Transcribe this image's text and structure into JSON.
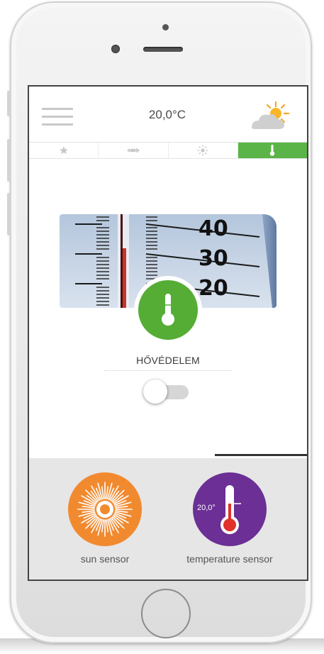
{
  "header": {
    "temperature": "20,0°C",
    "menu_icon": "hamburger-icon",
    "weather_icon": "sun-behind-cloud-icon"
  },
  "tabs": [
    {
      "icon": "star-icon",
      "active": false
    },
    {
      "icon": "wind-icon",
      "active": false
    },
    {
      "icon": "sun-icon",
      "active": false
    },
    {
      "icon": "thermometer-icon",
      "active": true
    }
  ],
  "hero": {
    "scale_labels": [
      "40",
      "30",
      "20"
    ],
    "badge_icon": "thermometer-icon"
  },
  "feature": {
    "label": "HŐVÉDELEM",
    "toggle_on": false
  },
  "sensors": [
    {
      "name": "sun sensor",
      "icon": "sunburst-icon",
      "color": "#f18a2f"
    },
    {
      "name": "temperature sensor",
      "icon": "thermometer-icon",
      "color": "#6b2f95",
      "value": "20,0°"
    }
  ],
  "colors": {
    "accent_green": "#5bb447",
    "sun_orange": "#f18a2f",
    "temp_purple": "#6b2f95"
  }
}
